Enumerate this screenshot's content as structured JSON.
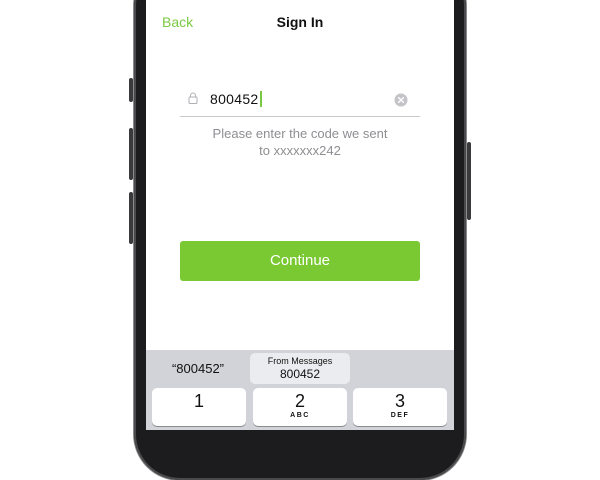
{
  "nav": {
    "back_label": "Back",
    "title": "Sign In"
  },
  "code_field": {
    "value": "800452"
  },
  "hint": {
    "line1": "Please enter the code we sent",
    "line2": "to xxxxxxx242"
  },
  "continue_label": "Continue",
  "keyboard": {
    "suggestion_quoted": "“800452”",
    "suggestion_source": "From Messages",
    "suggestion_code": "800452",
    "keys": [
      {
        "digit": "1",
        "letters": ""
      },
      {
        "digit": "2",
        "letters": "ABC"
      },
      {
        "digit": "3",
        "letters": "DEF"
      }
    ]
  },
  "colors": {
    "accent": "#7ac943",
    "button": "#7ac933",
    "keyboard_bg": "#d1d3d9"
  }
}
